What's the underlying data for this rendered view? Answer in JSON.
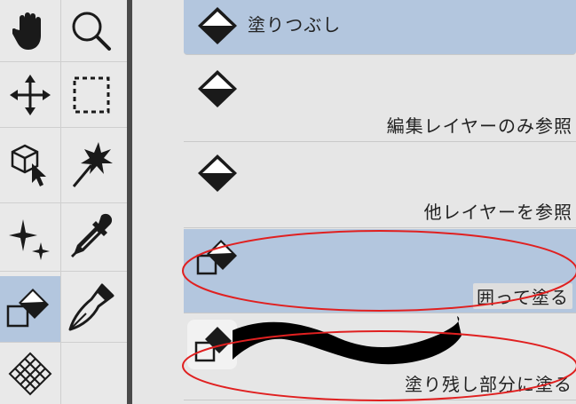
{
  "tools": [
    {
      "name": "hand-tool",
      "icon": "hand-icon"
    },
    {
      "name": "zoom-tool",
      "icon": "magnifier-icon"
    },
    {
      "name": "move-tool",
      "icon": "move-arrows-icon"
    },
    {
      "name": "selection-tool",
      "icon": "marquee-icon"
    },
    {
      "name": "operation-tool",
      "icon": "cube-cursor-icon"
    },
    {
      "name": "auto-select-tool",
      "icon": "magic-wand-icon"
    },
    {
      "name": "eraser-sparkle-tool",
      "icon": "sparkle-icon"
    },
    {
      "name": "eyedropper-tool",
      "icon": "eyedropper-icon"
    },
    {
      "name": "fill-tool",
      "icon": "fill-bucket-icon",
      "active": true
    },
    {
      "name": "pen-tool",
      "icon": "pen-nib-icon"
    },
    {
      "name": "pattern-tool",
      "icon": "crosshatch-icon"
    }
  ],
  "subtools": [
    {
      "label": "塗りつぶし",
      "selected": true
    },
    {
      "label": "編集レイヤーのみ参照",
      "selected": false
    },
    {
      "label": "他レイヤーを参照",
      "selected": false
    },
    {
      "label": "囲って塗る",
      "selected": true
    },
    {
      "label": "塗り残し部分に塗る",
      "selected": false
    }
  ],
  "colors": {
    "selected_bg": "#b3c6de",
    "annotation_red": "#e02020",
    "redaction_black": "#000000"
  }
}
